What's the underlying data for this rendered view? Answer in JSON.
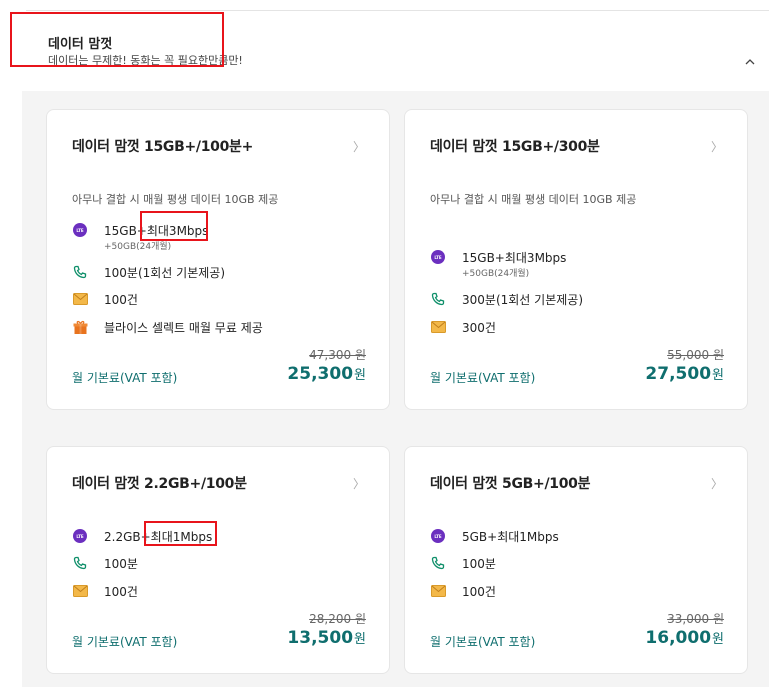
{
  "section": {
    "title": "데이터 맘껏",
    "subtitle": "데이터는 무제한! 동화는 꼭 필요한만큼만!"
  },
  "colors": {
    "accent": "#0f6e6e",
    "highlight": "#e8141b",
    "lte_badge": "#6b2fbf"
  },
  "icons": {
    "data": "lte-badge-icon",
    "call": "phone-icon",
    "message": "envelope-icon",
    "gift": "gift-icon",
    "arrow": "chevron-right-icon",
    "collapse": "chevron-up-icon"
  },
  "plans": [
    {
      "title": "데이터 맘껏 15GB+/100분+",
      "desc": "아무나 결합 시 매월 평생 데이터 10GB 제공",
      "data": "15GB+최대3Mbps",
      "data_sub": "+50GB(24개월)",
      "call": "100분(1회선 기본제공)",
      "message": "100건",
      "benefit": "블라이스 셀렉트 매월 무료 제공",
      "orig_price": "47,300 원",
      "price_label": "월 기본료(VAT 포함)",
      "price": "25,300",
      "unit": "원"
    },
    {
      "title": "데이터 맘껏 15GB+/300분",
      "desc": "아무나 결합 시 매월 평생 데이터 10GB 제공",
      "data": "15GB+최대3Mbps",
      "data_sub": "+50GB(24개월)",
      "call": "300분(1회선 기본제공)",
      "message": "300건",
      "orig_price": "55,000 원",
      "price_label": "월 기본료(VAT 포함)",
      "price": "27,500",
      "unit": "원"
    },
    {
      "title": "데이터 맘껏 2.2GB+/100분",
      "data": "2.2GB+최대1Mbps",
      "call": "100분",
      "message": "100건",
      "orig_price": "28,200 원",
      "price_label": "월 기본료(VAT 포함)",
      "price": "13,500",
      "unit": "원"
    },
    {
      "title": "데이터 맘껏 5GB+/100분",
      "data": "5GB+최대1Mbps",
      "call": "100분",
      "message": "100건",
      "orig_price": "33,000 원",
      "price_label": "월 기본료(VAT 포함)",
      "price": "16,000",
      "unit": "원"
    }
  ]
}
